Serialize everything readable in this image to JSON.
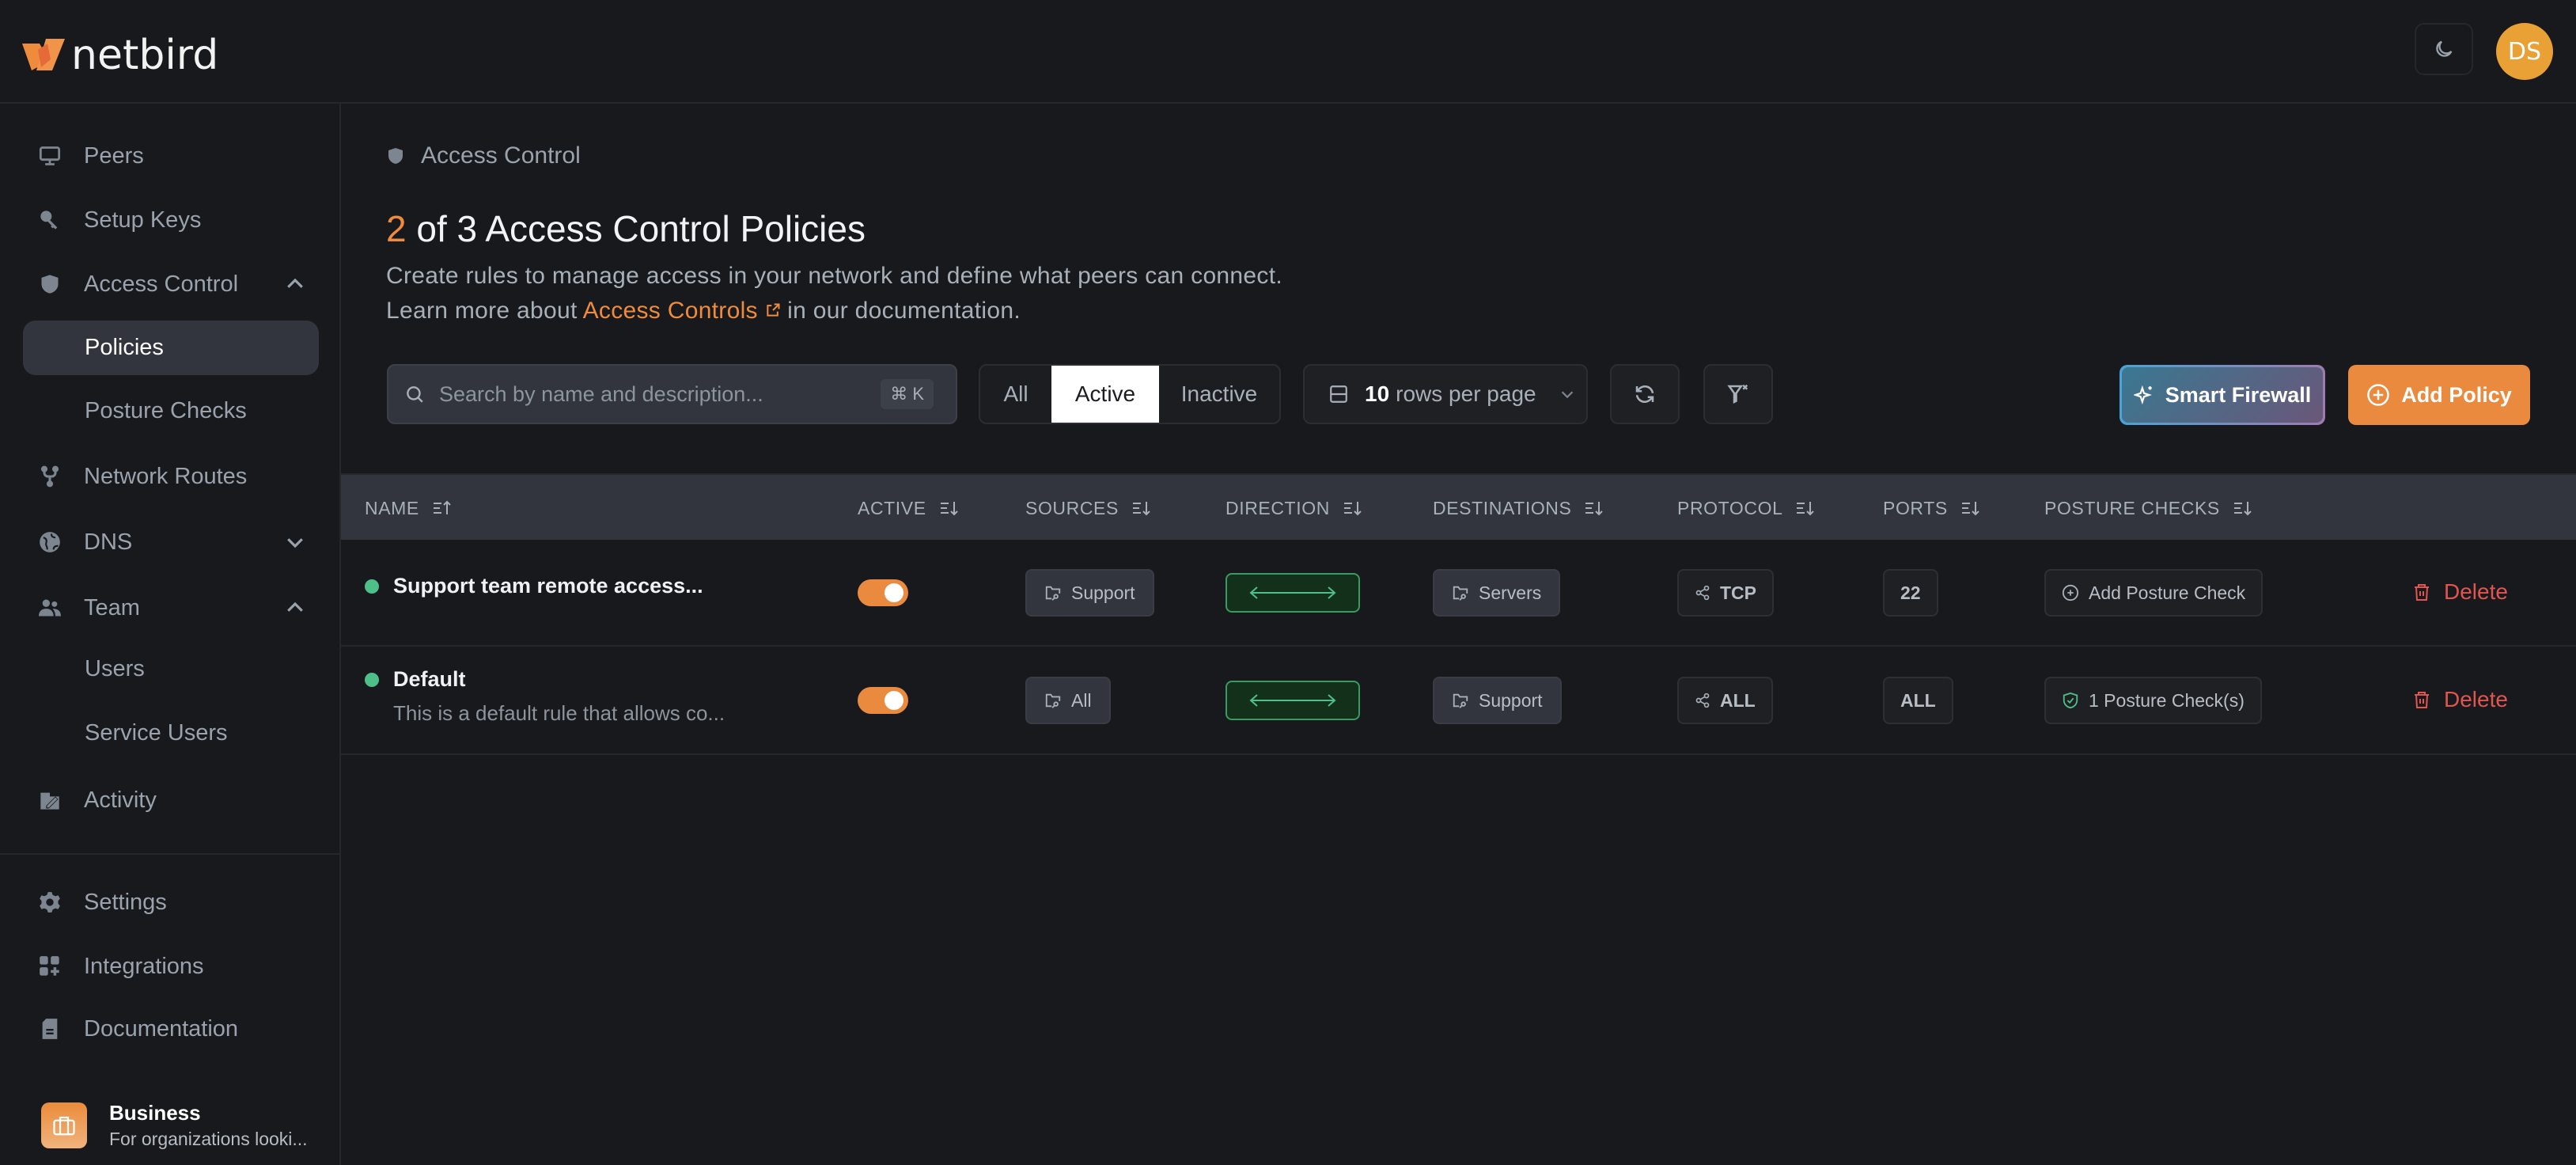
{
  "app": {
    "name": "netbird"
  },
  "header": {
    "avatar_initials": "DS",
    "theme_toggle_icon": "moon-icon"
  },
  "colors": {
    "accent": "#ea8a3f",
    "active_green": "#4fbf8a",
    "danger": "#e0564f",
    "avatar": "#e9a135"
  },
  "sidebar": {
    "items": [
      {
        "label": "Peers",
        "icon": "monitor-icon"
      },
      {
        "label": "Setup Keys",
        "icon": "key-icon"
      },
      {
        "label": "Access Control",
        "icon": "shield-icon",
        "expanded": true
      },
      {
        "label": "Network Routes",
        "icon": "route-fork-icon"
      },
      {
        "label": "DNS",
        "icon": "globe-icon",
        "expanded": false
      },
      {
        "label": "Team",
        "icon": "users-icon",
        "expanded": true
      },
      {
        "label": "Activity",
        "icon": "activity-edit-icon"
      }
    ],
    "access_control_sub": [
      {
        "label": "Policies",
        "active": true
      },
      {
        "label": "Posture Checks"
      }
    ],
    "team_sub": [
      {
        "label": "Users"
      },
      {
        "label": "Service Users"
      }
    ],
    "bottom_items": [
      {
        "label": "Settings",
        "icon": "gear-icon"
      },
      {
        "label": "Integrations",
        "icon": "grid-plus-icon"
      },
      {
        "label": "Documentation",
        "icon": "document-icon"
      }
    ],
    "plan": {
      "title": "Business",
      "subtitle": "For organizations looki..."
    }
  },
  "main": {
    "breadcrumb": "Access Control",
    "title_count": "2",
    "title_rest": " of 3 Access Control Policies",
    "description_line1": "Create rules to manage access in your network and define what peers can connect.",
    "description_prefix": "Learn more about ",
    "description_link": "Access Controls",
    "description_suffix": " in our documentation.",
    "search_placeholder": "Search by name and description...",
    "search_shortcut": "⌘ K",
    "filters": [
      "All",
      "Active",
      "Inactive"
    ],
    "selected_filter": "Active",
    "rows_per_page_value": "10",
    "rows_per_page_label": "rows per page",
    "smart_firewall_label": "Smart Firewall",
    "add_policy_label": "Add Policy"
  },
  "table": {
    "columns": [
      "NAME",
      "ACTIVE",
      "SOURCES",
      "DIRECTION",
      "DESTINATIONS",
      "PROTOCOL",
      "PORTS",
      "POSTURE CHECKS"
    ],
    "rows": [
      {
        "name": "Support team remote access...",
        "description": "",
        "enabled": true,
        "source": "Support",
        "direction": "bidirectional",
        "destination": "Servers",
        "protocol": "TCP",
        "ports": "22",
        "posture": "Add Posture Check",
        "delete_label": "Delete"
      },
      {
        "name": "Default",
        "description": "This is a default rule that allows co...",
        "enabled": true,
        "source": "All",
        "direction": "bidirectional",
        "destination": "Support",
        "protocol": "ALL",
        "ports": "ALL",
        "posture": "1 Posture Check(s)",
        "delete_label": "Delete"
      }
    ]
  }
}
